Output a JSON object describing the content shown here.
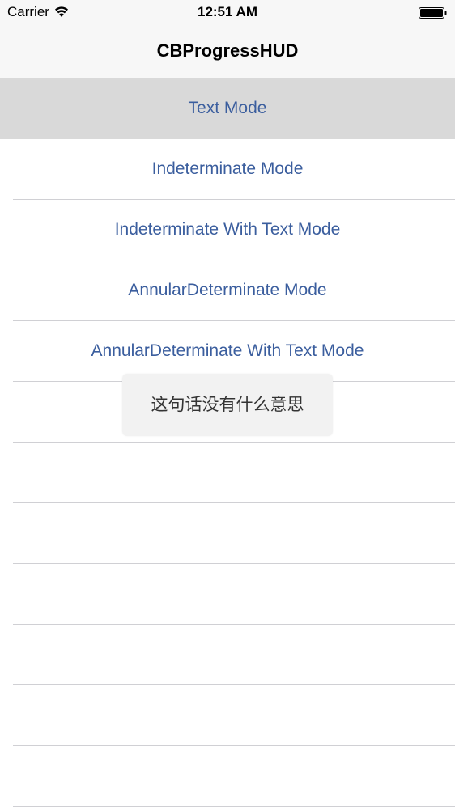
{
  "status_bar": {
    "carrier": "Carrier",
    "time": "12:51 AM",
    "wifi_icon": "wifi-icon",
    "battery_icon": "battery-icon"
  },
  "nav": {
    "title": "CBProgressHUD"
  },
  "table": {
    "rows": [
      {
        "label": "Text Mode",
        "selected": true
      },
      {
        "label": "Indeterminate Mode"
      },
      {
        "label": "Indeterminate With Text Mode"
      },
      {
        "label": "AnnularDeterminate Mode"
      },
      {
        "label": "AnnularDeterminate With Text Mode"
      },
      {
        "label": ""
      },
      {
        "label": ""
      },
      {
        "label": ""
      },
      {
        "label": ""
      },
      {
        "label": ""
      },
      {
        "label": ""
      },
      {
        "label": ""
      }
    ]
  },
  "hud": {
    "text": "这句话没有什么意思"
  },
  "colors": {
    "link": "#3b5e9e",
    "selected_row": "#d9d9d9",
    "bar_background": "#f7f7f7",
    "separator": "#d0d0d4"
  }
}
